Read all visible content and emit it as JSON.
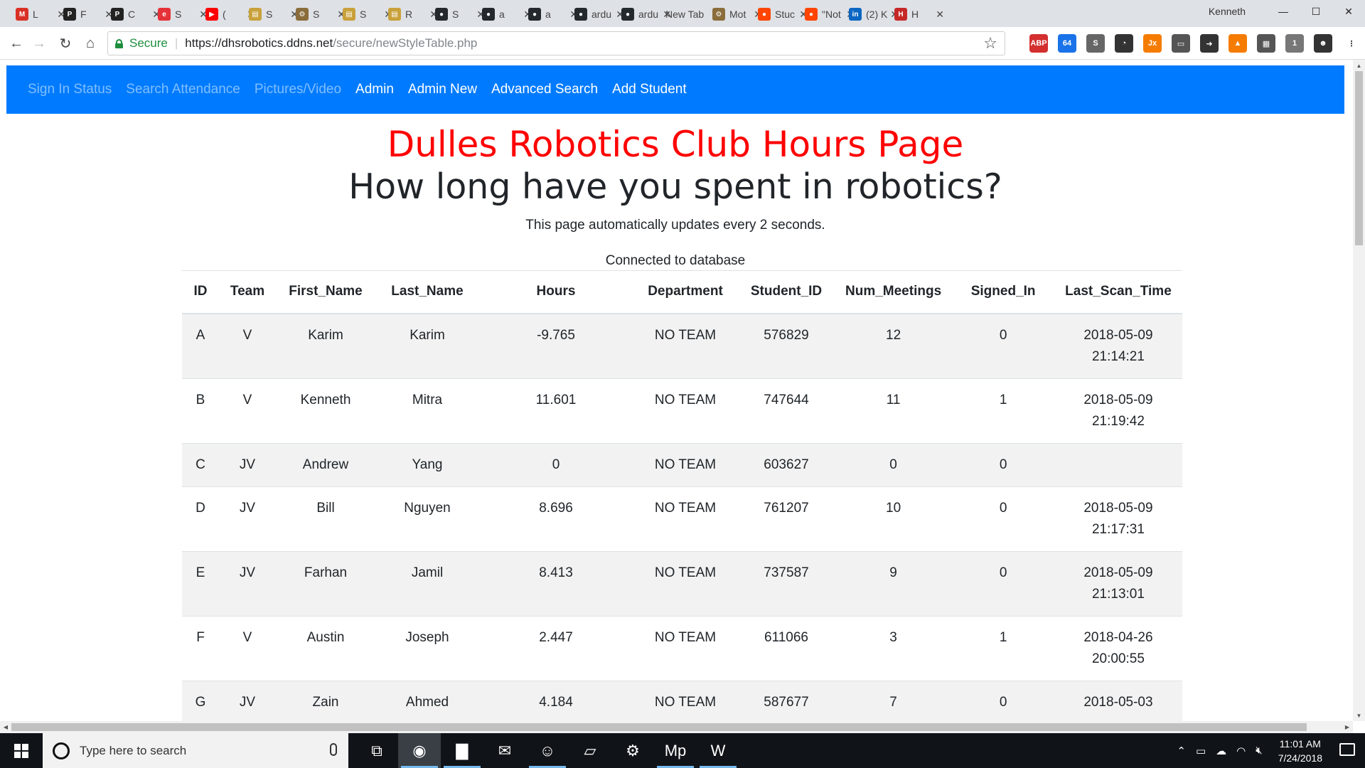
{
  "browser": {
    "tabs": [
      {
        "label": "L",
        "icon": "gmail-icon",
        "color": "#d93025",
        "glyph": "M"
      },
      {
        "label": "F",
        "icon": "pluralsight-icon",
        "color": "#222222",
        "glyph": "P"
      },
      {
        "label": "C",
        "icon": "pluralsight-icon",
        "color": "#222222",
        "glyph": "P"
      },
      {
        "label": "S",
        "icon": "ebay-icon",
        "color": "#e53238",
        "glyph": "e"
      },
      {
        "label": "(",
        "icon": "youtube-icon",
        "color": "#ff0000",
        "glyph": "▶"
      },
      {
        "label": "S",
        "icon": "document-icon",
        "color": "#c9a13b",
        "glyph": "▤"
      },
      {
        "label": "S",
        "icon": "gear-icon",
        "color": "#8a6d3b",
        "glyph": "⚙"
      },
      {
        "label": "S",
        "icon": "document-icon",
        "color": "#c9a13b",
        "glyph": "▤"
      },
      {
        "label": "R",
        "icon": "document-icon",
        "color": "#c9a13b",
        "glyph": "▤"
      },
      {
        "label": "S",
        "icon": "github-icon",
        "color": "#24292e",
        "glyph": "●"
      },
      {
        "label": "a",
        "icon": "github-icon",
        "color": "#24292e",
        "glyph": "●"
      },
      {
        "label": "a",
        "icon": "github-icon",
        "color": "#24292e",
        "glyph": "●"
      },
      {
        "label": "ardu",
        "icon": "github-icon",
        "color": "#24292e",
        "glyph": "●"
      },
      {
        "label": "ardu",
        "icon": "github-icon",
        "color": "#24292e",
        "glyph": "●"
      },
      {
        "label": "New Tab",
        "icon": "",
        "color": "",
        "glyph": ""
      },
      {
        "label": "Mot",
        "icon": "gear-icon",
        "color": "#8a6d3b",
        "glyph": "⚙"
      },
      {
        "label": "Stuc",
        "icon": "reddit-icon",
        "color": "#ff4500",
        "glyph": "●"
      },
      {
        "label": "\"Not",
        "icon": "reddit-icon",
        "color": "#ff4500",
        "glyph": "●"
      },
      {
        "label": "(2) K",
        "icon": "linkedin-icon",
        "color": "#0a66c2",
        "glyph": "in"
      },
      {
        "label": "H",
        "icon": "page-icon",
        "color": "#c62828",
        "glyph": "H"
      }
    ],
    "profile_name": "Kenneth",
    "omnibox": {
      "secure_label": "Secure",
      "url_host": "https://dhsrobotics.ddns.net",
      "url_path": "/secure/newStyleTable.php"
    },
    "extensions": [
      {
        "name": "adblock-plus-icon",
        "label": "ABP",
        "color": "#d3302f"
      },
      {
        "name": "calendar-icon",
        "label": "64",
        "color": "#1a73e8"
      },
      {
        "name": "s-extension-icon",
        "label": "S",
        "color": "#666666"
      },
      {
        "name": "speed-dial-icon",
        "label": "◔",
        "color": "#333333"
      },
      {
        "name": "jx-extension-icon",
        "label": "Jx",
        "color": "#f57c00"
      },
      {
        "name": "chat-icon",
        "label": "▭",
        "color": "#555555"
      },
      {
        "name": "arrow-extension-icon",
        "label": "➜",
        "color": "#333333"
      },
      {
        "name": "fox-icon",
        "label": "▲",
        "color": "#f57c00"
      },
      {
        "name": "grid-extension-icon",
        "label": "▦",
        "color": "#555555"
      },
      {
        "name": "notify-extension-icon",
        "label": "1",
        "color": "#777777"
      },
      {
        "name": "mask-icon",
        "label": "☻",
        "color": "#333333"
      },
      {
        "name": "menu-icon",
        "label": "⋮",
        "color": "#ffffff"
      }
    ]
  },
  "navbar": {
    "links": [
      {
        "label": "Sign In Status",
        "style": "muted"
      },
      {
        "label": "Search Attendance",
        "style": "muted"
      },
      {
        "label": "Pictures/Video",
        "style": "muted"
      },
      {
        "label": "Admin",
        "style": "bright"
      },
      {
        "label": "Admin New",
        "style": "bright"
      },
      {
        "label": "Advanced Search",
        "style": "bright"
      },
      {
        "label": "Add Student",
        "style": "bright"
      }
    ],
    "color": "#007bff"
  },
  "page": {
    "title_red": "Dulles Robotics Club Hours Page",
    "title_main": "How long have you spent in robotics?",
    "update_note": "This page automatically updates every 2 seconds.",
    "db_status": "Connected to database"
  },
  "table": {
    "columns": [
      "ID",
      "Team",
      "First_Name",
      "Last_Name",
      "Hours",
      "Department",
      "Student_ID",
      "Num_Meetings",
      "Signed_In",
      "Last_Scan_Time"
    ],
    "rows": [
      [
        "A",
        "V",
        "Karim",
        "Karim",
        "-9.765",
        "NO TEAM",
        "576829",
        "12",
        "0",
        "2018-05-09 21:14:21"
      ],
      [
        "B",
        "V",
        "Kenneth",
        "Mitra",
        "11.601",
        "NO TEAM",
        "747644",
        "11",
        "1",
        "2018-05-09 21:19:42"
      ],
      [
        "C",
        "JV",
        "Andrew",
        "Yang",
        "0",
        "NO TEAM",
        "603627",
        "0",
        "0",
        ""
      ],
      [
        "D",
        "JV",
        "Bill",
        "Nguyen",
        "8.696",
        "NO TEAM",
        "761207",
        "10",
        "0",
        "2018-05-09 21:17:31"
      ],
      [
        "E",
        "JV",
        "Farhan",
        "Jamil",
        "8.413",
        "NO TEAM",
        "737587",
        "9",
        "0",
        "2018-05-09 21:13:01"
      ],
      [
        "F",
        "V",
        "Austin",
        "Joseph",
        "2.447",
        "NO TEAM",
        "611066",
        "3",
        "1",
        "2018-04-26 20:00:55"
      ],
      [
        "G",
        "JV",
        "Zain",
        "Ahmed",
        "4.184",
        "NO TEAM",
        "587677",
        "7",
        "0",
        "2018-05-03"
      ]
    ]
  },
  "taskbar": {
    "search_placeholder": "Type here to search",
    "apps": [
      {
        "name": "task-view-icon",
        "glyph": "⧉",
        "state": ""
      },
      {
        "name": "chrome-icon",
        "glyph": "◉",
        "state": "active"
      },
      {
        "name": "file-explorer-icon",
        "glyph": "▇",
        "state": "open"
      },
      {
        "name": "mail-icon",
        "glyph": "✉",
        "state": ""
      },
      {
        "name": "discord-icon",
        "glyph": "☺",
        "state": "open"
      },
      {
        "name": "notes-icon",
        "glyph": "▱",
        "state": ""
      },
      {
        "name": "settings-icon",
        "glyph": "⚙",
        "state": ""
      },
      {
        "name": "mplab-icon",
        "glyph": "Mp",
        "state": "open"
      },
      {
        "name": "word-icon",
        "glyph": "W",
        "state": "open"
      }
    ],
    "time": "11:01 AM",
    "date": "7/24/2018"
  }
}
